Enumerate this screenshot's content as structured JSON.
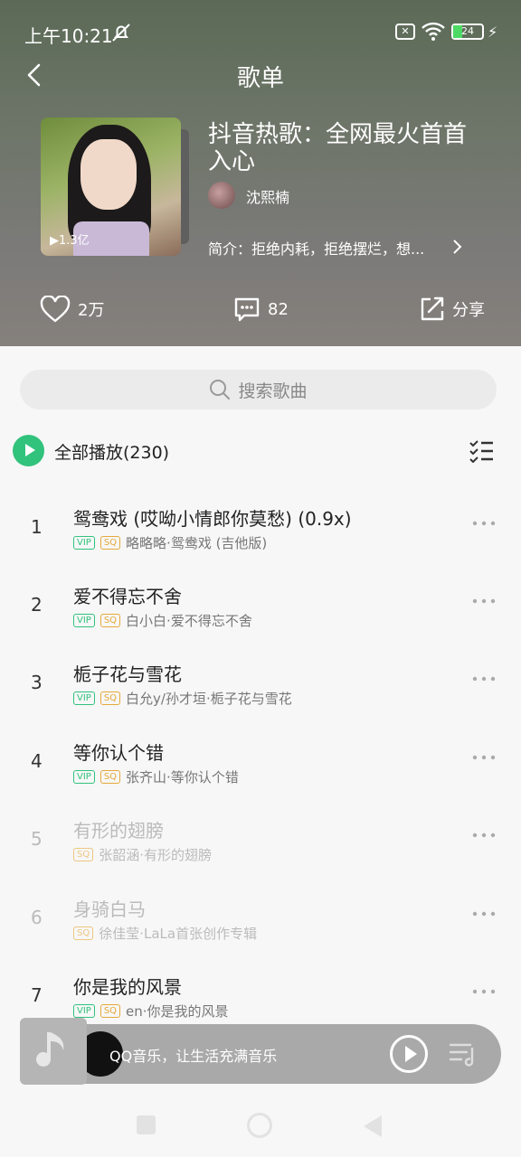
{
  "status": {
    "time": "上午10:21",
    "battery": "24"
  },
  "header": {
    "title": "歌单"
  },
  "playlist": {
    "title": "抖音热歌：全网最火首首入心",
    "creator": "沈熙楠",
    "intro": "简介：拒绝内耗，拒绝摆烂，想...",
    "plays": "1.3亿"
  },
  "actions": {
    "likes": "2万",
    "comments": "82",
    "share": "分享"
  },
  "search": {
    "placeholder": "搜索歌曲"
  },
  "play_all": {
    "label": "全部播放(230)"
  },
  "songs": [
    {
      "index": "1",
      "title": "鸳鸯戏 (哎呦小情郎你莫愁) (0.9x)",
      "tags": [
        "VIP",
        "SQ"
      ],
      "subtitle": "略略略·鸳鸯戏 (吉他版)"
    },
    {
      "index": "2",
      "title": "爱不得忘不舍",
      "tags": [
        "VIP",
        "SQ"
      ],
      "subtitle": "白小白·爱不得忘不舍"
    },
    {
      "index": "3",
      "title": "栀子花与雪花",
      "tags": [
        "VIP",
        "SQ"
      ],
      "subtitle": "白允y/孙才垣·栀子花与雪花"
    },
    {
      "index": "4",
      "title": "等你认个错",
      "tags": [
        "VIP",
        "SQ"
      ],
      "subtitle": "张齐山·等你认个错"
    },
    {
      "index": "5",
      "title": "有形的翅膀",
      "tags": [
        "SQ"
      ],
      "subtitle": "张韶涵·有形的翅膀"
    },
    {
      "index": "6",
      "title": "身骑白马",
      "tags": [
        "SQ"
      ],
      "subtitle": "徐佳莹·LaLa首张创作专辑"
    },
    {
      "index": "7",
      "title": "你是我的风景",
      "tags": [
        "VIP",
        "SQ"
      ],
      "subtitle": "en·你是我的风景"
    }
  ],
  "player": {
    "text": "QQ音乐，让生活充满音乐"
  },
  "colors": {
    "accent": "#31c27c",
    "vip": "#31c27c",
    "sq": "#e6a93a"
  }
}
